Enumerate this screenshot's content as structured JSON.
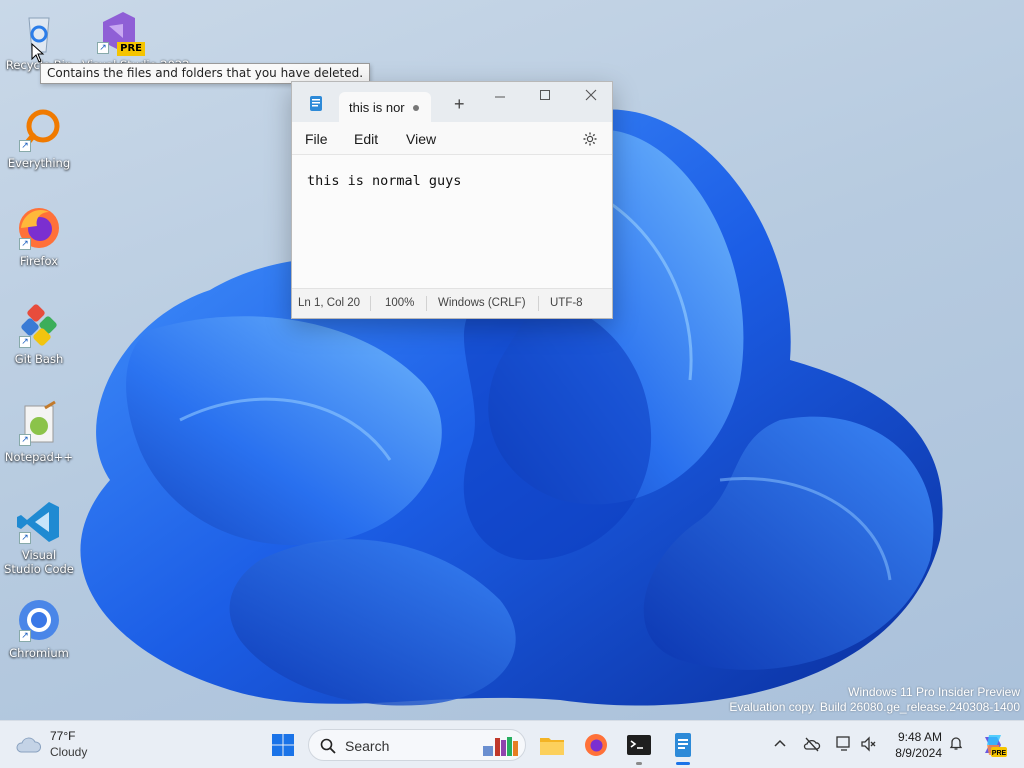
{
  "desktop": {
    "icons": [
      {
        "label": "Recycle Bin"
      },
      {
        "label": "Visual Studio 2022",
        "badge": "PRE"
      },
      {
        "label": "Everything"
      },
      {
        "label": "Firefox"
      },
      {
        "label": "Git Bash"
      },
      {
        "label": "Notepad++"
      },
      {
        "label": "Visual Studio Code"
      },
      {
        "label": "Chromium"
      }
    ],
    "tooltip": "Contains the files and folders that you have deleted."
  },
  "notepad": {
    "tab_title": "this is nor",
    "new_tab": "+",
    "menu": {
      "file": "File",
      "edit": "Edit",
      "view": "View"
    },
    "content": "this is normal guys",
    "status": {
      "position": "Ln 1, Col 20",
      "zoom": "100%",
      "line_ending": "Windows (CRLF)",
      "encoding": "UTF-8"
    }
  },
  "watermark": {
    "line1": "Windows 11 Pro Insider Preview",
    "line2": "Evaluation copy. Build 26080.ge_release.240308-1400"
  },
  "taskbar": {
    "weather": {
      "temp": "77°F",
      "condition": "Cloudy"
    },
    "search_placeholder": "Search",
    "clock": {
      "time": "9:48 AM",
      "date": "8/9/2024"
    }
  },
  "colors": {
    "accent": "#1d5fbf",
    "taskbar_bg": "#e9eef5",
    "bloom": "#1f5fe0"
  }
}
